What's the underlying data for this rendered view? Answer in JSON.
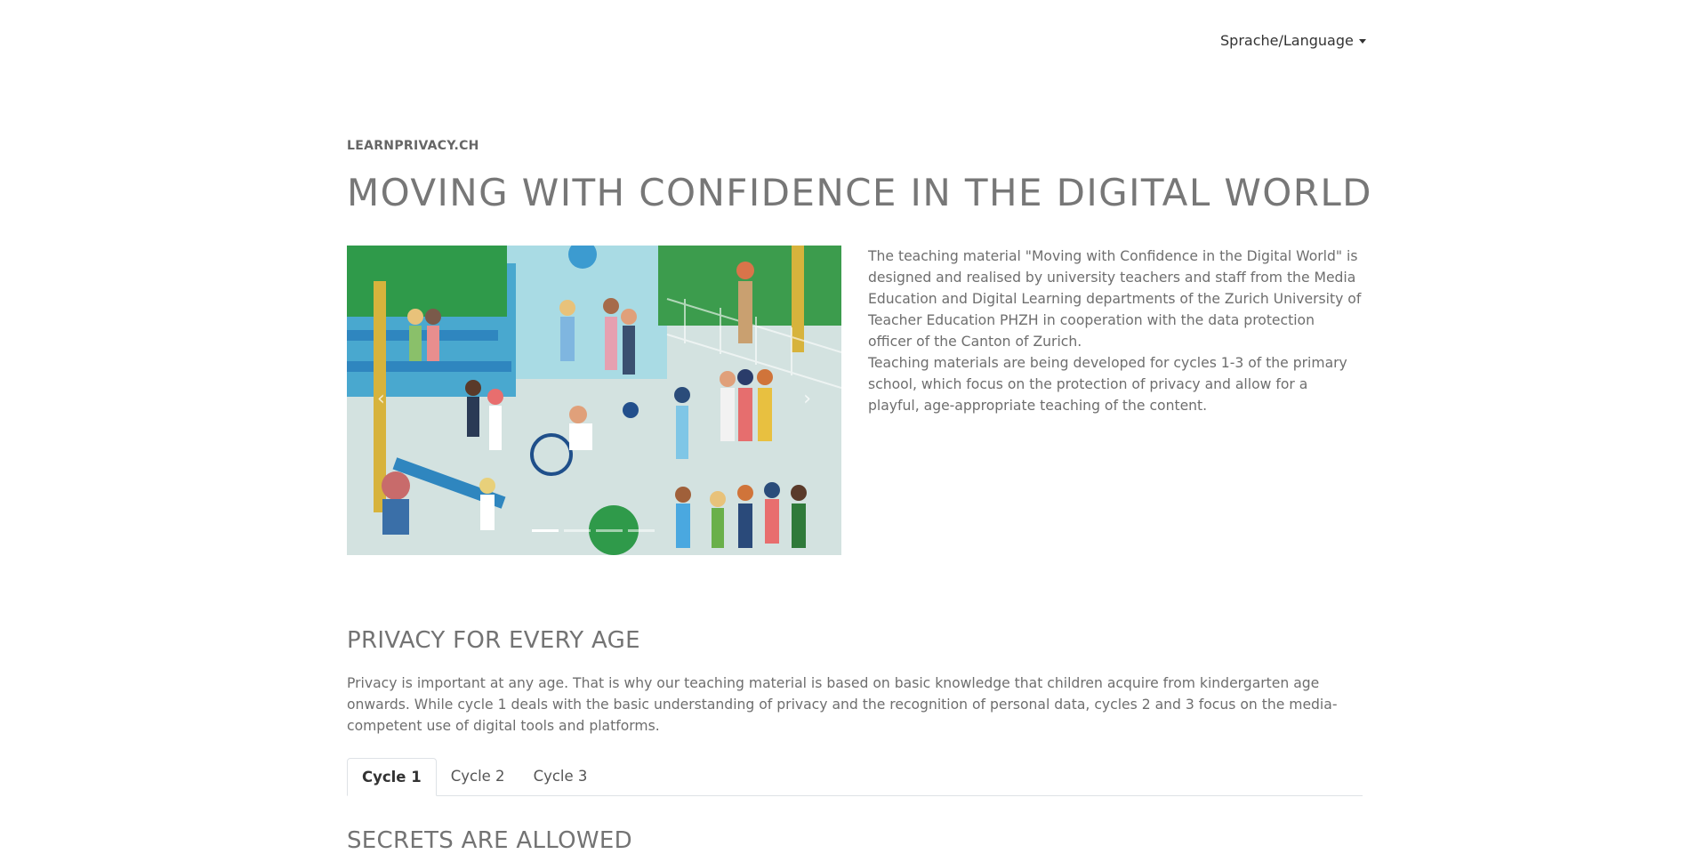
{
  "nav": {
    "language_label": "Sprache/Language"
  },
  "header": {
    "kicker": "LEARNPRIVACY.CH",
    "title": "MOVING WITH CONFIDENCE IN THE DIGITAL WORLD"
  },
  "carousel": {
    "active_index": 0,
    "slide_count": 4,
    "prev_icon": "chevron-left-icon",
    "next_icon": "chevron-right-icon"
  },
  "intro": {
    "paragraph_1": "The teaching material \"Moving with Confidence in the Digital World\" is designed and realised by university teachers and staff from the Media Education and Digital Learning departments of the Zurich University of Teacher Education PHZH in cooperation with the data protection officer of the Canton of Zurich.",
    "paragraph_2": "Teaching materials are being developed for cycles 1-3 of the primary school, which focus on the protection of privacy and allow for a playful, age-appropriate teaching of the content."
  },
  "section": {
    "title": "PRIVACY FOR EVERY AGE",
    "text": "Privacy is important at any age. That is why our teaching material is based on basic knowledge that children acquire from kindergarten age onwards. While cycle 1 deals with the basic understanding of privacy and the recognition of personal data, cycles 2 and 3 focus on the media-competent use of digital tools and platforms."
  },
  "tabs": [
    {
      "label": "Cycle 1",
      "active": true
    },
    {
      "label": "Cycle 2",
      "active": false
    },
    {
      "label": "Cycle 3",
      "active": false
    }
  ],
  "next_section": {
    "title": "SECRETS ARE ALLOWED"
  }
}
